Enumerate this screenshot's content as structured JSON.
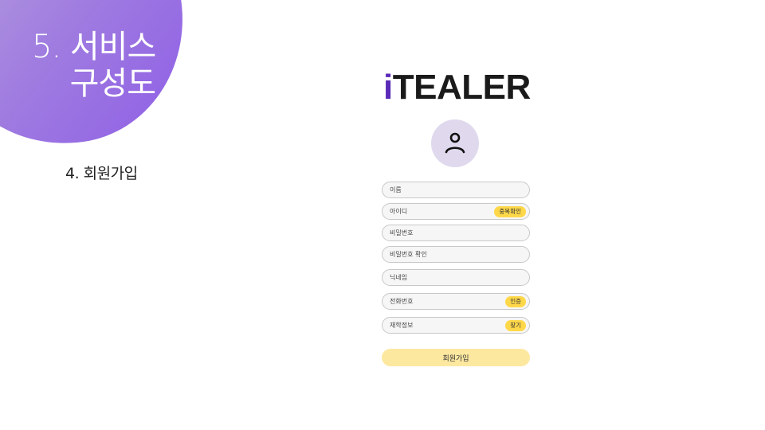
{
  "section": {
    "title_line1": "5. 서비스",
    "title_line2": "구성도",
    "subtitle": "4. 회원가입"
  },
  "logo": {
    "first_letter": "i",
    "rest": "TEALER",
    "accent_color": "#5a2ab8"
  },
  "avatar": {
    "icon": "user-icon"
  },
  "form": {
    "fields": [
      {
        "label": "이름"
      },
      {
        "label": "아이디",
        "action": "중복확인"
      },
      {
        "label": "비밀번호"
      },
      {
        "label": "비밀번호 확인"
      },
      {
        "label": "닉네임"
      },
      {
        "label": "전화번호",
        "action": "인증"
      },
      {
        "label": "재학정보",
        "action": "찾기"
      }
    ],
    "submit_label": "회원가입"
  }
}
